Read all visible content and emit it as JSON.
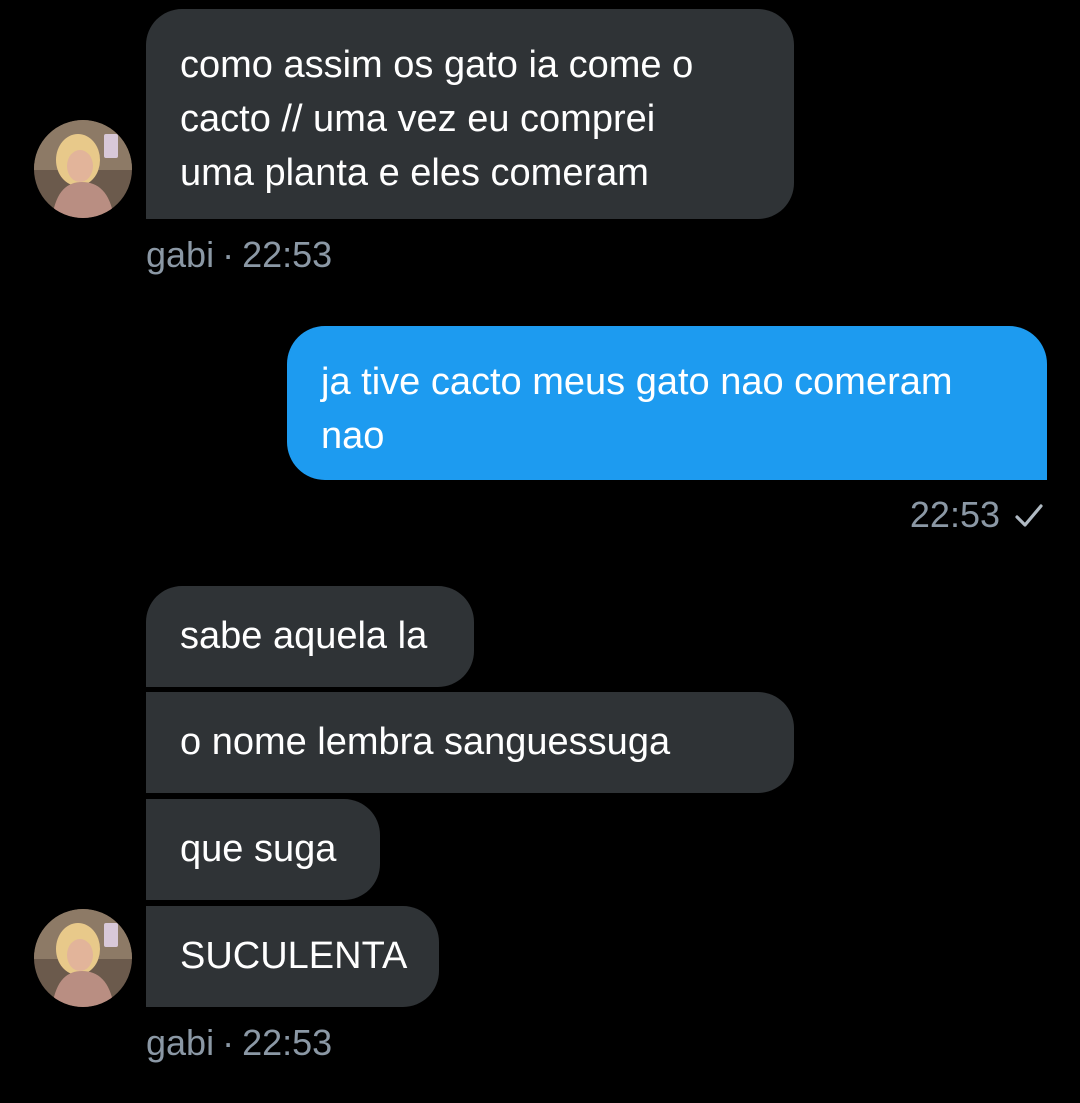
{
  "colors": {
    "background": "#000000",
    "incoming_bubble": "#2f3336",
    "outgoing_bubble": "#1d9bf0",
    "meta_text": "#8b98a5"
  },
  "messages": {
    "m1": {
      "lines": [
        "como assim os gato ia come o",
        "cacto // uma vez eu comprei",
        "uma planta e eles comeram"
      ]
    },
    "meta1": {
      "sender": "gabi",
      "separator": "·",
      "time": "22:53"
    },
    "m2": {
      "lines": [
        "ja tive cacto meus gato nao comeram",
        "nao"
      ]
    },
    "meta2": {
      "time": "22:53",
      "status_icon": "check-icon"
    },
    "m3": {
      "text": "sabe aquela la"
    },
    "m4": {
      "text": "o nome lembra sanguessuga"
    },
    "m5": {
      "text": "que suga"
    },
    "m6": {
      "text": "SUCULENTA"
    },
    "meta3": {
      "sender": "gabi",
      "separator": "·",
      "time": "22:53"
    }
  }
}
